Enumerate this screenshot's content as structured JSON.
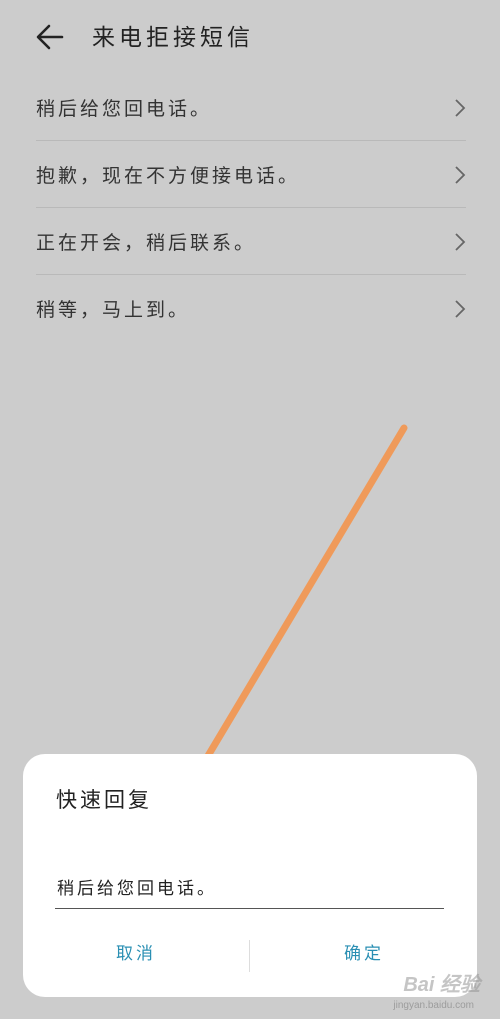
{
  "header": {
    "title": "来电拒接短信",
    "back_icon": "arrow-left-icon"
  },
  "replies": [
    {
      "label": "稍后给您回电话。"
    },
    {
      "label": "抱歉，现在不方便接电话。"
    },
    {
      "label": "正在开会，稍后联系。"
    },
    {
      "label": "稍等，马上到。"
    }
  ],
  "annotation": {
    "color": "#ef9a5a"
  },
  "dialog": {
    "title": "快速回复",
    "input_value": "稍后给您回电话。",
    "cancel_label": "取消",
    "ok_label": "确定",
    "button_color": "#2a8fb3"
  },
  "watermark": {
    "brand": "Bai 经验",
    "url": "jingyan.baidu.com"
  }
}
